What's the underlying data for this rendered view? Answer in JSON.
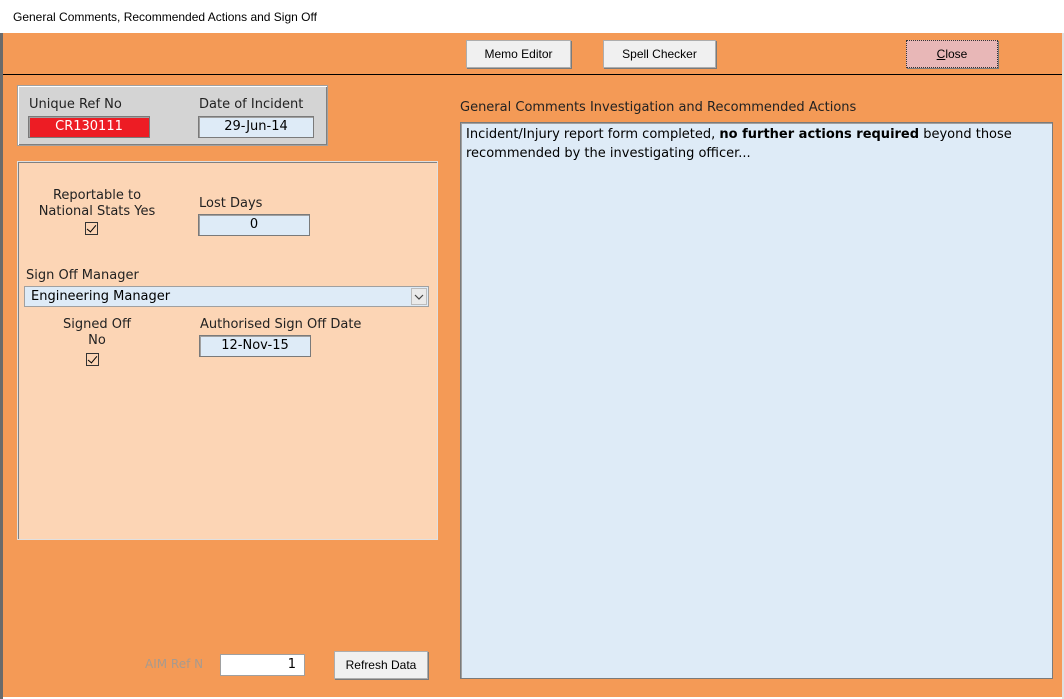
{
  "window": {
    "title": "General Comments, Recommended Actions and Sign Off"
  },
  "toolbar": {
    "memo_editor_label": "Memo Editor",
    "spell_checker_label": "Spell Checker",
    "close_label_prefix": "",
    "close_label_underlined": "C",
    "close_label_rest": "lose"
  },
  "header_panel": {
    "unique_ref_label": "Unique Ref No",
    "unique_ref_value": "CR130111",
    "date_of_incident_label": "Date of Incident",
    "date_of_incident_value": "29-Jun-14"
  },
  "details": {
    "reportable_label_line1": "Reportable to",
    "reportable_label_line2": "National Stats Yes",
    "reportable_checked": true,
    "lost_days_label": "Lost Days",
    "lost_days_value": "0",
    "sign_off_manager_label": "Sign Off Manager",
    "sign_off_manager_value": "Engineering Manager",
    "signed_off_label_line1": "Signed Off",
    "signed_off_label_line2": "No",
    "signed_off_checked": true,
    "authorised_date_label": "Authorised Sign Off Date",
    "authorised_date_value": "12-Nov-15"
  },
  "comments": {
    "label": "General Comments Investigation and Recommended Actions",
    "text_before_bold": "Incident/Injury report form completed, ",
    "text_bold": "no further actions required",
    "text_after_bold": " beyond those recommended by the investigating officer..."
  },
  "footer": {
    "aim_ref_label": "AIM Ref N",
    "aim_ref_value": "1",
    "refresh_label": "Refresh Data"
  },
  "colors": {
    "form_background": "#f49a56",
    "panel_background": "#fcd5b5",
    "field_background": "#deebf7",
    "ref_highlight": "#ed1c24",
    "close_button": "#e8b7b7"
  }
}
